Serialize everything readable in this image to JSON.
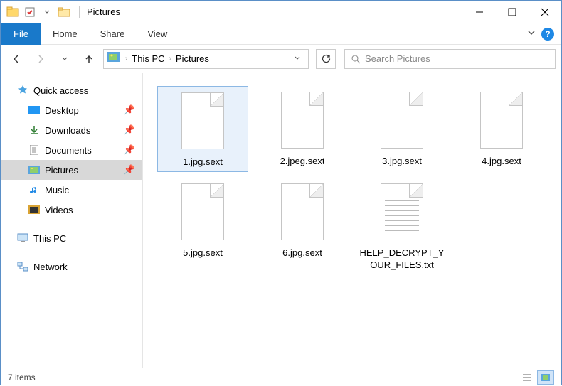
{
  "window": {
    "title": "Pictures"
  },
  "ribbon": {
    "file": "File",
    "tabs": [
      "Home",
      "Share",
      "View"
    ]
  },
  "breadcrumb": {
    "items": [
      "This PC",
      "Pictures"
    ]
  },
  "search": {
    "placeholder": "Search Pictures"
  },
  "sidebar": {
    "quick_access": "Quick access",
    "items": [
      {
        "label": "Desktop",
        "pinned": true
      },
      {
        "label": "Downloads",
        "pinned": true
      },
      {
        "label": "Documents",
        "pinned": true
      },
      {
        "label": "Pictures",
        "pinned": true,
        "selected": true
      },
      {
        "label": "Music",
        "pinned": false
      },
      {
        "label": "Videos",
        "pinned": false
      }
    ],
    "this_pc": "This PC",
    "network": "Network"
  },
  "files": [
    {
      "name": "1.jpg.sext",
      "type": "blank",
      "selected": true
    },
    {
      "name": "2.jpeg.sext",
      "type": "blank"
    },
    {
      "name": "3.jpg.sext",
      "type": "blank"
    },
    {
      "name": "4.jpg.sext",
      "type": "blank"
    },
    {
      "name": "5.jpg.sext",
      "type": "blank"
    },
    {
      "name": "6.jpg.sext",
      "type": "blank"
    },
    {
      "name": "HELP_DECRYPT_YOUR_FILES.txt",
      "type": "txt"
    }
  ],
  "status": {
    "count": "7 items"
  }
}
